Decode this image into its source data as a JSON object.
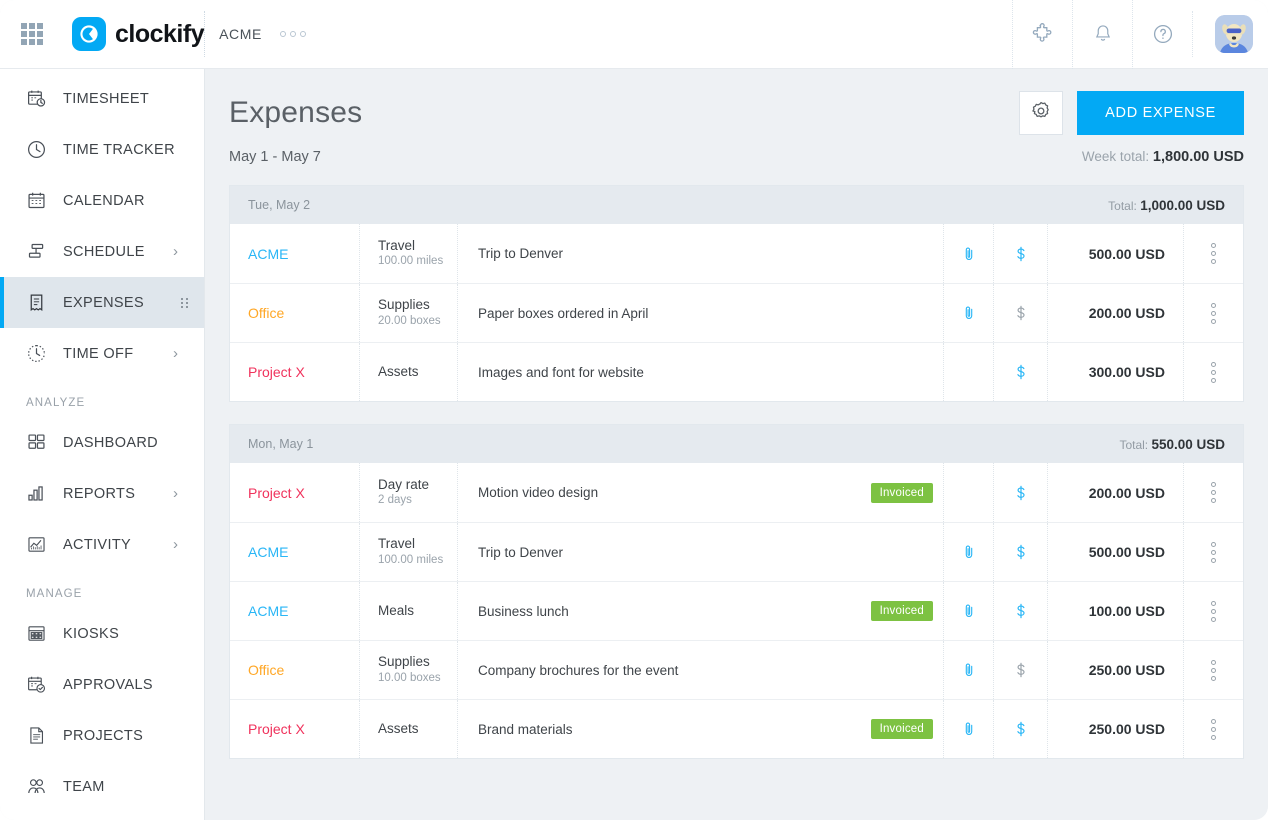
{
  "topbar": {
    "apps_icon": "apps-grid-icon",
    "logo_text": "clockify",
    "workspace": "ACME",
    "more_icon": "more-horizontal-icon",
    "icons": [
      {
        "name": "integrations-puzzle-icon",
        "glyph": "puzzle"
      },
      {
        "name": "notifications-bell-icon",
        "glyph": "bell"
      },
      {
        "name": "help-question-icon",
        "glyph": "question"
      }
    ],
    "avatar_name": "user-avatar"
  },
  "sidebar": {
    "items": [
      {
        "label": "TIMESHEET",
        "icon": "timesheet-icon",
        "chevron": false,
        "active": false
      },
      {
        "label": "TIME TRACKER",
        "icon": "clock-icon",
        "chevron": false,
        "active": false
      },
      {
        "label": "CALENDAR",
        "icon": "calendar-icon",
        "chevron": false,
        "active": false
      },
      {
        "label": "SCHEDULE",
        "icon": "schedule-icon",
        "chevron": true,
        "active": false
      },
      {
        "label": "EXPENSES",
        "icon": "receipt-icon",
        "chevron": false,
        "active": true
      },
      {
        "label": "TIME OFF",
        "icon": "time-off-icon",
        "chevron": true,
        "active": false
      }
    ],
    "section_analyze": "ANALYZE",
    "analyze_items": [
      {
        "label": "DASHBOARD",
        "icon": "dashboard-icon",
        "chevron": false
      },
      {
        "label": "REPORTS",
        "icon": "reports-bar-icon",
        "chevron": true
      },
      {
        "label": "ACTIVITY",
        "icon": "activity-chart-icon",
        "chevron": true
      }
    ],
    "section_manage": "MANAGE",
    "manage_items": [
      {
        "label": "KIOSKS",
        "icon": "kiosk-icon",
        "chevron": false
      },
      {
        "label": "APPROVALS",
        "icon": "approvals-icon",
        "chevron": false
      },
      {
        "label": "PROJECTS",
        "icon": "projects-doc-icon",
        "chevron": false
      },
      {
        "label": "TEAM",
        "icon": "team-people-icon",
        "chevron": false
      }
    ],
    "chevron_glyph": "›"
  },
  "page": {
    "title": "Expenses",
    "settings_icon": "gear-icon",
    "add_button": "ADD EXPENSE",
    "date_range": "May 1 - May 7",
    "week_total_label": "Week total:",
    "week_total_value": "1,800.00 USD"
  },
  "colors": {
    "accent": "#03a9f4",
    "badge_green": "#7dc242",
    "project_acme": "#29b6f6",
    "project_office": "#ffa726",
    "project_x": "#f0325c",
    "billable_on": "#29b6f6",
    "billable_off": "#9aa3ab",
    "clip_on": "#29b6f6"
  },
  "groups": [
    {
      "date": "Tue, May 2",
      "total_label": "Total:",
      "total_value": "1,000.00 USD",
      "rows": [
        {
          "project": "ACME",
          "project_color": "#29b6f6",
          "category": "Travel",
          "quantity": "100.00 miles",
          "description": "Trip to Denver",
          "invoiced": false,
          "has_attachment": true,
          "billable": true,
          "amount": "500.00 USD"
        },
        {
          "project": "Office",
          "project_color": "#ffa726",
          "category": "Supplies",
          "quantity": "20.00 boxes",
          "description": "Paper boxes ordered in April",
          "invoiced": false,
          "has_attachment": true,
          "billable": false,
          "amount": "200.00 USD"
        },
        {
          "project": "Project X",
          "project_color": "#f0325c",
          "category": "Assets",
          "quantity": "",
          "description": "Images and font for website",
          "invoiced": false,
          "has_attachment": false,
          "billable": true,
          "amount": "300.00 USD"
        }
      ]
    },
    {
      "date": "Mon, May 1",
      "total_label": "Total:",
      "total_value": "550.00 USD",
      "rows": [
        {
          "project": "Project X",
          "project_color": "#f0325c",
          "category": "Day rate",
          "quantity": "2 days",
          "description": "Motion video design",
          "invoiced": true,
          "invoiced_label": "Invoiced",
          "has_attachment": false,
          "billable": true,
          "amount": "200.00 USD"
        },
        {
          "project": "ACME",
          "project_color": "#29b6f6",
          "category": "Travel",
          "quantity": "100.00 miles",
          "description": "Trip to Denver",
          "invoiced": false,
          "has_attachment": true,
          "billable": true,
          "amount": "500.00 USD"
        },
        {
          "project": "ACME",
          "project_color": "#29b6f6",
          "category": "Meals",
          "quantity": "",
          "description": "Business lunch",
          "invoiced": true,
          "invoiced_label": "Invoiced",
          "has_attachment": true,
          "billable": true,
          "amount": "100.00 USD"
        },
        {
          "project": "Office",
          "project_color": "#ffa726",
          "category": "Supplies",
          "quantity": "10.00 boxes",
          "description": "Company brochures for the event",
          "invoiced": false,
          "has_attachment": true,
          "billable": false,
          "amount": "250.00 USD"
        },
        {
          "project": "Project X",
          "project_color": "#f0325c",
          "category": "Assets",
          "quantity": "",
          "description": "Brand materials",
          "invoiced": true,
          "invoiced_label": "Invoiced",
          "has_attachment": true,
          "billable": true,
          "amount": "250.00 USD"
        }
      ]
    }
  ]
}
